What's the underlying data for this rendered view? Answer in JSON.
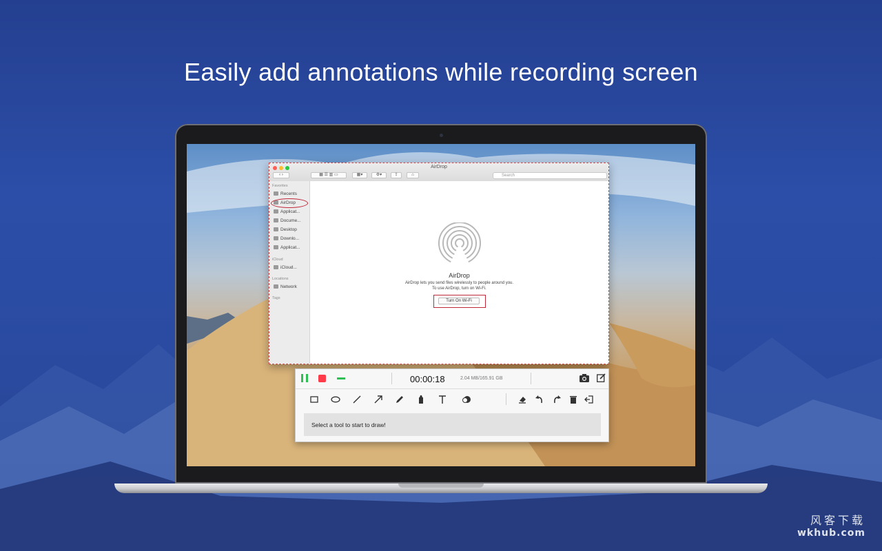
{
  "headline": "Easily add annotations while recording screen",
  "finder": {
    "title": "AirDrop",
    "search_placeholder": "Search",
    "sidebar": {
      "favorites_label": "Favorites",
      "favorites": [
        "Recents",
        "AirDrop",
        "Applicat...",
        "Docume...",
        "Desktop",
        "Downlo...",
        "Applicat..."
      ],
      "icloud_label": "iCloud",
      "icloud": [
        "iCloud..."
      ],
      "locations_label": "Locations",
      "locations": [
        "Network"
      ],
      "tags_label": "Tags"
    },
    "airdrop_heading": "AirDrop",
    "airdrop_desc_line1": "AirDrop lets you send files wirelessly to people around you.",
    "airdrop_desc_line2": "To use AirDrop, turn on Wi-Fi.",
    "wifi_button": "Turn On Wi-Fi"
  },
  "recorder": {
    "timer": "00:00:18",
    "storage": "2.04 MB/165.91 GB",
    "hint": "Select a tool to start to draw!",
    "tools": [
      "rectangle-tool-icon",
      "ellipse-tool-icon",
      "line-tool-icon",
      "arrow-tool-icon",
      "pen-tool-icon",
      "highlighter-tool-icon",
      "text-tool-icon",
      "blur-tool-icon",
      "eraser-icon",
      "undo-icon",
      "redo-icon",
      "trash-icon",
      "exit-draw-icon"
    ],
    "colors": {
      "pause": "#2fbf55",
      "stop": "#ff3b4a"
    }
  },
  "watermark": {
    "line1": "风客下载",
    "line2": "wkhub.com"
  }
}
